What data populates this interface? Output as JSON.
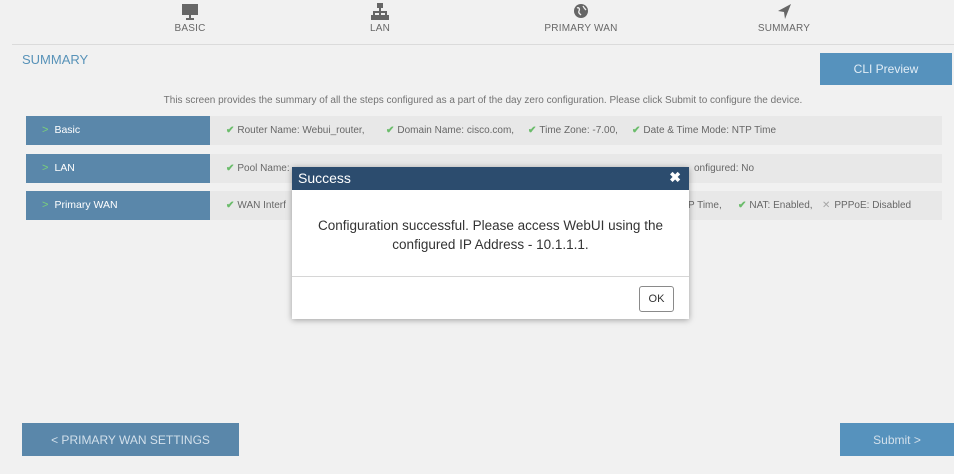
{
  "steps": [
    {
      "label": "BASIC",
      "icon": "monitor-icon"
    },
    {
      "label": "LAN",
      "icon": "network-icon"
    },
    {
      "label": "PRIMARY WAN",
      "icon": "globe-icon"
    },
    {
      "label": "SUMMARY",
      "icon": "navigation-arrow-icon"
    }
  ],
  "summary": {
    "title": "SUMMARY",
    "cli_preview": "CLI Preview",
    "intro": "This screen provides the summary of all the steps configured as a part of the day zero configuration. Please click Submit to configure the device."
  },
  "rows": [
    {
      "key": "Basic",
      "items": [
        "Router Name: Webui_router,",
        "Domain Name: cisco.com,",
        "Time Zone: -7.00,",
        "Date & Time Mode: NTP Time"
      ]
    },
    {
      "key": "LAN",
      "left": "Pool Name:",
      "right": "onfigured: No"
    },
    {
      "key": "Primary WAN",
      "left": "WAN Interf",
      "right_time": "P Time,",
      "right_nat": "NAT: Enabled,",
      "right_pppoe": "PPPoE: Disabled"
    }
  ],
  "buttons": {
    "back": "< PRIMARY WAN SETTINGS",
    "submit": "Submit >"
  },
  "modal": {
    "title": "Success",
    "close": "✖",
    "message": "Configuration successful. Please access WebUI using the configured IP Address - 10.1.1.1.",
    "ok": "OK"
  },
  "colors": {
    "accent": "#1e6ea7",
    "row_key": "#235f8e",
    "modal_header": "#2c4c6e",
    "check": "#3aa63a"
  }
}
